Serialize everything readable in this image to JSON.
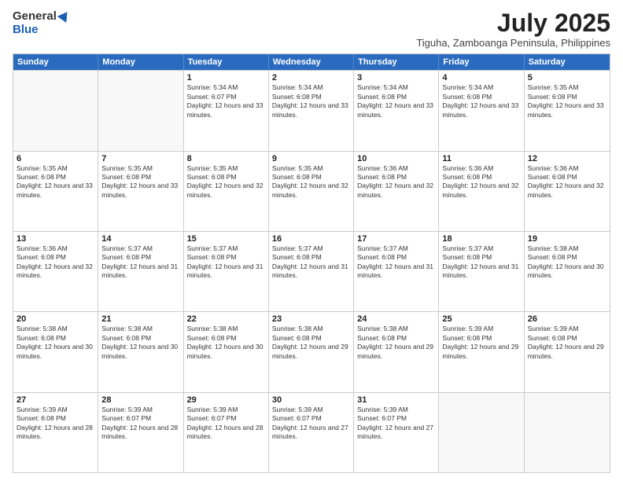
{
  "logo": {
    "general": "General",
    "blue": "Blue"
  },
  "header": {
    "month_year": "July 2025",
    "location": "Tiguha, Zamboanga Peninsula, Philippines"
  },
  "days_of_week": [
    "Sunday",
    "Monday",
    "Tuesday",
    "Wednesday",
    "Thursday",
    "Friday",
    "Saturday"
  ],
  "weeks": [
    [
      {
        "day": "",
        "empty": true
      },
      {
        "day": "",
        "empty": true
      },
      {
        "day": "1",
        "sunrise": "Sunrise: 5:34 AM",
        "sunset": "Sunset: 6:07 PM",
        "daylight": "Daylight: 12 hours and 33 minutes."
      },
      {
        "day": "2",
        "sunrise": "Sunrise: 5:34 AM",
        "sunset": "Sunset: 6:08 PM",
        "daylight": "Daylight: 12 hours and 33 minutes."
      },
      {
        "day": "3",
        "sunrise": "Sunrise: 5:34 AM",
        "sunset": "Sunset: 6:08 PM",
        "daylight": "Daylight: 12 hours and 33 minutes."
      },
      {
        "day": "4",
        "sunrise": "Sunrise: 5:34 AM",
        "sunset": "Sunset: 6:08 PM",
        "daylight": "Daylight: 12 hours and 33 minutes."
      },
      {
        "day": "5",
        "sunrise": "Sunrise: 5:35 AM",
        "sunset": "Sunset: 6:08 PM",
        "daylight": "Daylight: 12 hours and 33 minutes."
      }
    ],
    [
      {
        "day": "6",
        "sunrise": "Sunrise: 5:35 AM",
        "sunset": "Sunset: 6:08 PM",
        "daylight": "Daylight: 12 hours and 33 minutes."
      },
      {
        "day": "7",
        "sunrise": "Sunrise: 5:35 AM",
        "sunset": "Sunset: 6:08 PM",
        "daylight": "Daylight: 12 hours and 33 minutes."
      },
      {
        "day": "8",
        "sunrise": "Sunrise: 5:35 AM",
        "sunset": "Sunset: 6:08 PM",
        "daylight": "Daylight: 12 hours and 32 minutes."
      },
      {
        "day": "9",
        "sunrise": "Sunrise: 5:35 AM",
        "sunset": "Sunset: 6:08 PM",
        "daylight": "Daylight: 12 hours and 32 minutes."
      },
      {
        "day": "10",
        "sunrise": "Sunrise: 5:36 AM",
        "sunset": "Sunset: 6:08 PM",
        "daylight": "Daylight: 12 hours and 32 minutes."
      },
      {
        "day": "11",
        "sunrise": "Sunrise: 5:36 AM",
        "sunset": "Sunset: 6:08 PM",
        "daylight": "Daylight: 12 hours and 32 minutes."
      },
      {
        "day": "12",
        "sunrise": "Sunrise: 5:36 AM",
        "sunset": "Sunset: 6:08 PM",
        "daylight": "Daylight: 12 hours and 32 minutes."
      }
    ],
    [
      {
        "day": "13",
        "sunrise": "Sunrise: 5:36 AM",
        "sunset": "Sunset: 6:08 PM",
        "daylight": "Daylight: 12 hours and 32 minutes."
      },
      {
        "day": "14",
        "sunrise": "Sunrise: 5:37 AM",
        "sunset": "Sunset: 6:08 PM",
        "daylight": "Daylight: 12 hours and 31 minutes."
      },
      {
        "day": "15",
        "sunrise": "Sunrise: 5:37 AM",
        "sunset": "Sunset: 6:08 PM",
        "daylight": "Daylight: 12 hours and 31 minutes."
      },
      {
        "day": "16",
        "sunrise": "Sunrise: 5:37 AM",
        "sunset": "Sunset: 6:08 PM",
        "daylight": "Daylight: 12 hours and 31 minutes."
      },
      {
        "day": "17",
        "sunrise": "Sunrise: 5:37 AM",
        "sunset": "Sunset: 6:08 PM",
        "daylight": "Daylight: 12 hours and 31 minutes."
      },
      {
        "day": "18",
        "sunrise": "Sunrise: 5:37 AM",
        "sunset": "Sunset: 6:08 PM",
        "daylight": "Daylight: 12 hours and 31 minutes."
      },
      {
        "day": "19",
        "sunrise": "Sunrise: 5:38 AM",
        "sunset": "Sunset: 6:08 PM",
        "daylight": "Daylight: 12 hours and 30 minutes."
      }
    ],
    [
      {
        "day": "20",
        "sunrise": "Sunrise: 5:38 AM",
        "sunset": "Sunset: 6:08 PM",
        "daylight": "Daylight: 12 hours and 30 minutes."
      },
      {
        "day": "21",
        "sunrise": "Sunrise: 5:38 AM",
        "sunset": "Sunset: 6:08 PM",
        "daylight": "Daylight: 12 hours and 30 minutes."
      },
      {
        "day": "22",
        "sunrise": "Sunrise: 5:38 AM",
        "sunset": "Sunset: 6:08 PM",
        "daylight": "Daylight: 12 hours and 30 minutes."
      },
      {
        "day": "23",
        "sunrise": "Sunrise: 5:38 AM",
        "sunset": "Sunset: 6:08 PM",
        "daylight": "Daylight: 12 hours and 29 minutes."
      },
      {
        "day": "24",
        "sunrise": "Sunrise: 5:38 AM",
        "sunset": "Sunset: 6:08 PM",
        "daylight": "Daylight: 12 hours and 29 minutes."
      },
      {
        "day": "25",
        "sunrise": "Sunrise: 5:39 AM",
        "sunset": "Sunset: 6:08 PM",
        "daylight": "Daylight: 12 hours and 29 minutes."
      },
      {
        "day": "26",
        "sunrise": "Sunrise: 5:39 AM",
        "sunset": "Sunset: 6:08 PM",
        "daylight": "Daylight: 12 hours and 29 minutes."
      }
    ],
    [
      {
        "day": "27",
        "sunrise": "Sunrise: 5:39 AM",
        "sunset": "Sunset: 6:08 PM",
        "daylight": "Daylight: 12 hours and 28 minutes."
      },
      {
        "day": "28",
        "sunrise": "Sunrise: 5:39 AM",
        "sunset": "Sunset: 6:07 PM",
        "daylight": "Daylight: 12 hours and 28 minutes."
      },
      {
        "day": "29",
        "sunrise": "Sunrise: 5:39 AM",
        "sunset": "Sunset: 6:07 PM",
        "daylight": "Daylight: 12 hours and 28 minutes."
      },
      {
        "day": "30",
        "sunrise": "Sunrise: 5:39 AM",
        "sunset": "Sunset: 6:07 PM",
        "daylight": "Daylight: 12 hours and 27 minutes."
      },
      {
        "day": "31",
        "sunrise": "Sunrise: 5:39 AM",
        "sunset": "Sunset: 6:07 PM",
        "daylight": "Daylight: 12 hours and 27 minutes."
      },
      {
        "day": "",
        "empty": true
      },
      {
        "day": "",
        "empty": true
      }
    ]
  ]
}
